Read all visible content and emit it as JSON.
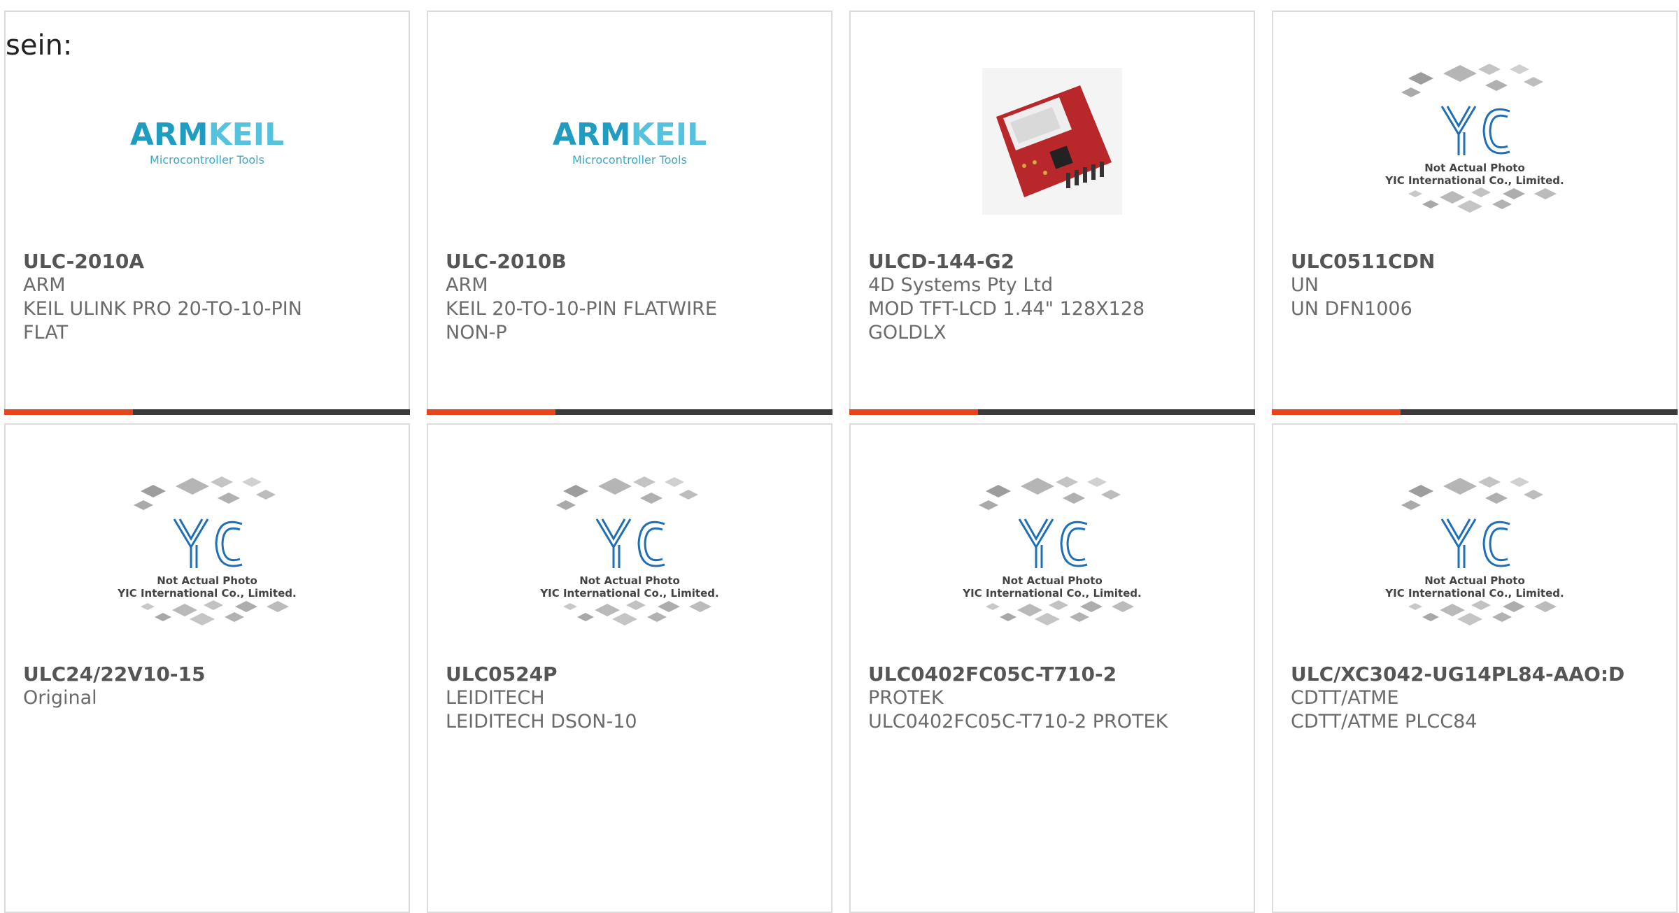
{
  "intro_text": "sein:",
  "products": [
    {
      "part": "ULC-2010A",
      "maker": "ARM",
      "desc1": "KEIL ULINK PRO 20-TO-10-PIN",
      "desc2": "FLAT",
      "image": "armkeil-logo"
    },
    {
      "part": "ULC-2010B",
      "maker": "ARM",
      "desc1": "KEIL 20-TO-10-PIN FLATWIRE",
      "desc2": "NON-P",
      "image": "armkeil-logo"
    },
    {
      "part": "ULCD-144-G2",
      "maker": "4D Systems Pty Ltd",
      "desc1": "MOD TFT-LCD 1.44\" 128X128",
      "desc2": "GOLDLX",
      "image": "lcd-module-photo"
    },
    {
      "part": "ULC0511CDN",
      "maker": "UN",
      "desc1": "UN DFN1006",
      "desc2": "",
      "image": "yic-placeholder"
    },
    {
      "part": "ULC24/22V10-15",
      "maker": "Original",
      "desc1": "",
      "desc2": "",
      "image": "yic-placeholder"
    },
    {
      "part": "ULC0524P",
      "maker": "LEIDITECH",
      "desc1": "LEIDITECH DSON-10",
      "desc2": "",
      "image": "yic-placeholder"
    },
    {
      "part": "ULC0402FC05C-T710-2",
      "maker": "PROTEK",
      "desc1": "ULC0402FC05C-T710-2 PROTEK",
      "desc2": "",
      "image": "yic-placeholder"
    },
    {
      "part": "ULC/XC3042-UG14PL84-AAO:D",
      "maker": "CDTT/ATME",
      "desc1": "CDTT/ATME PLCC84",
      "desc2": "",
      "image": "yic-placeholder"
    }
  ],
  "armkeil": {
    "brand_a": "ARM",
    "brand_b": "KEIL",
    "tagline": "Microcontroller Tools"
  },
  "yic": {
    "line1": "Not Actual Photo",
    "line2": "YIC International Co., Limited."
  },
  "colors": {
    "accent": "#e8441b",
    "bar": "#3a3a3a",
    "border": "#dcdcdc",
    "arm_blue": "#1f9cc0",
    "yic_blue": "#1e6fb5"
  }
}
